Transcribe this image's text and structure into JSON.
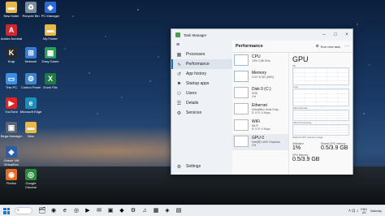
{
  "desktop": {
    "icons": [
      {
        "label": "New folder",
        "color": "#e8b84a",
        "glyph": "▬"
      },
      {
        "label": "Recycle Bin",
        "color": "#7c8a99",
        "glyph": "♻"
      },
      {
        "label": "PC Manager",
        "color": "#2f6bd8",
        "glyph": "◆"
      },
      {
        "label": "Adobe Acrobat",
        "color": "#d1262d",
        "glyph": "A"
      },
      {
        "label": "My Folder",
        "color": "#e8b84a",
        "glyph": "▬"
      },
      {
        "label": "Krap",
        "color": "#2a2a2a",
        "glyph": "K"
      },
      {
        "label": "Network",
        "color": "#3a7bd5",
        "glyph": "⊞"
      },
      {
        "label": "Easy Game",
        "color": "#2d9c5a",
        "glyph": "▦"
      },
      {
        "label": "This PC",
        "color": "#3a8fe0",
        "glyph": "▭"
      },
      {
        "label": "Control Panel",
        "color": "#3f83c8",
        "glyph": "⚙"
      },
      {
        "label": "Excel File",
        "color": "#1f7a45",
        "glyph": "X"
      },
      {
        "label": "YouTube",
        "color": "#e02424",
        "glyph": "▶"
      },
      {
        "label": "Microsoft Edge",
        "color": "#1a8fb8",
        "glyph": "e"
      },
      {
        "label": "Bega Manager",
        "color": "#5b6470",
        "glyph": "▣"
      },
      {
        "label": "New",
        "color": "#e8b84a",
        "glyph": "▬"
      },
      {
        "label": "Oracle VM VirtualBox",
        "color": "#2c5ea8",
        "glyph": "◈"
      },
      {
        "label": "Firefox",
        "color": "#e66a1f",
        "glyph": "◉"
      },
      {
        "label": "Google Chrome",
        "color": "#2b8a3e",
        "glyph": "◎"
      }
    ]
  },
  "task_manager": {
    "window_title": "Task Manager",
    "nav": {
      "items": [
        {
          "label": "Processes",
          "icon": "▦"
        },
        {
          "label": "Performance",
          "icon": "∿"
        },
        {
          "label": "App history",
          "icon": "↺"
        },
        {
          "label": "Startup apps",
          "icon": "⚑"
        },
        {
          "label": "Users",
          "icon": "⚇"
        },
        {
          "label": "Details",
          "icon": "☰"
        },
        {
          "label": "Services",
          "icon": "⚙"
        }
      ],
      "settings_label": "Settings"
    },
    "main": {
      "title": "Performance",
      "run_new_task": "Run new task",
      "more": "···"
    },
    "perf_items": [
      {
        "name": "CPU",
        "sub1": "13% 2.88 GHz",
        "sub2": ""
      },
      {
        "name": "Memory",
        "sub1": "3.0/7.8 GB (38%)",
        "sub2": ""
      },
      {
        "name": "Disk 0 (C:)",
        "sub1": "SSD",
        "sub2": "1%"
      },
      {
        "name": "Ethernet",
        "sub1": "VirtualBox Host-Only...",
        "sub2": "S: 0  R: 0 Kbps"
      },
      {
        "name": "WiFi",
        "sub1": "Wi-Fi",
        "sub2": "S: 0  R: 0 Kbps"
      },
      {
        "name": "GPU 0",
        "sub1": "Intel(R) UHD Graphics",
        "sub2": "1%"
      }
    ],
    "gpu": {
      "title": "GPU",
      "graph_labels": [
        "3D",
        "Copy",
        "Video Decode",
        "Video Processing"
      ],
      "shared_label": "Shared GPU memory usage",
      "utilization_label": "Utilization",
      "utilization_value": "1%",
      "shared_mem_label": "Shared GPU memory",
      "shared_mem_value": "0.5/3.9 GB",
      "gpu_mem_label": "GPU Memory",
      "gpu_mem_value": "0.5/3.9 GB"
    }
  },
  "taskbar": {
    "search": "⌕",
    "apps": [
      "🗂",
      "◉",
      "e",
      "◎",
      "▶",
      "✉",
      "▣",
      "◆",
      "⚙",
      "♫",
      "▦",
      "◈",
      "▤"
    ],
    "tray": {
      "icons": "˄ ⊡ ♪",
      "lang_top": "ENG",
      "lang_bottom": "US",
      "time": "",
      "day": "Saturday"
    }
  }
}
